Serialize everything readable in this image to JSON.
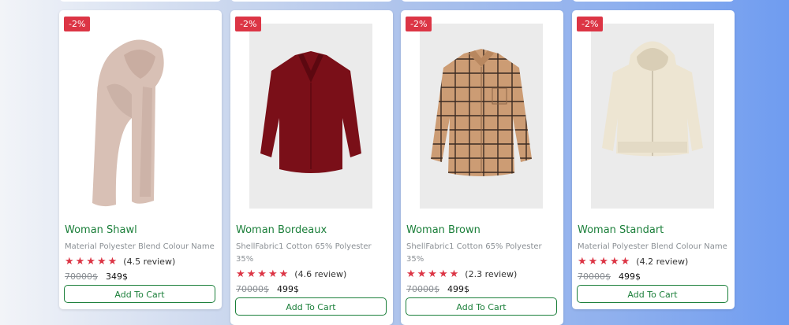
{
  "products": [
    {
      "badge": "-2%",
      "title": "Woman Shawl",
      "description": "Material Polyester Blend Colour Name",
      "stars": "★★★★★",
      "review": "(4.5 review)",
      "old_price": "70000$",
      "price": "349$",
      "cart_label": "Add To Cart",
      "image_icon": "scarf-image",
      "color": "#d8c0b5"
    },
    {
      "badge": "-2%",
      "title": "Woman Bordeaux",
      "description": "ShellFabric1 Cotton 65% Polyester 35%",
      "stars": "★★★★★",
      "review": "(4.6 review)",
      "old_price": "70000$",
      "price": "499$",
      "cart_label": "Add To Cart",
      "image_icon": "shirt-image",
      "color": "#7a0f18"
    },
    {
      "badge": "-2%",
      "title": "Woman Brown",
      "description": "ShellFabric1 Cotton 65% Polyester 35%",
      "stars": "★★★★★",
      "review": "(2.3 review)",
      "old_price": "70000$",
      "price": "499$",
      "cart_label": "Add To Cart",
      "image_icon": "plaid-shirt-image",
      "color": "#cc9c74"
    },
    {
      "badge": "-2%",
      "title": "Woman Standart",
      "description": "Material Polyester Blend Colour Name",
      "stars": "★★★★★",
      "review": "(4.2 review)",
      "old_price": "70000$",
      "price": "499$",
      "cart_label": "Add To Cart",
      "image_icon": "hoodie-image",
      "color": "#ede5d2"
    }
  ]
}
